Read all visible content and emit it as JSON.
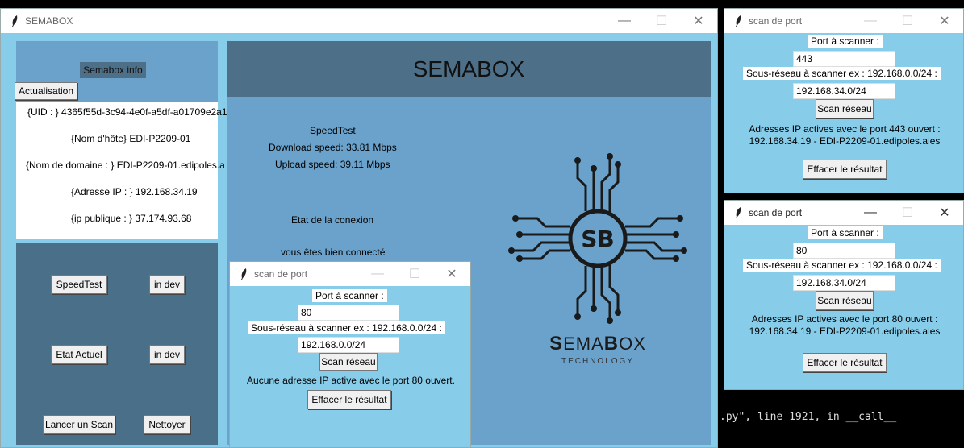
{
  "main_window": {
    "title": "SEMABOX",
    "sidebar_top": {
      "info_label": "Semabox info",
      "refresh_button": "Actualisation",
      "info_lines": [
        "{UID : } 4365f55d-3c94-4e0f-a5df-a01709e2a1",
        "{Nom d'hôte} EDI-P2209-01",
        "{Nom de domaine : } EDI-P2209-01.edipoles.a",
        "{Adresse IP : } 192.168.34.19",
        "{ip publique : } 37.174.93.68"
      ]
    },
    "sidebar_buttons": {
      "speedtest": "SpeedTest",
      "in_dev_1": "in dev",
      "etat_actuel": "Etat Actuel",
      "in_dev_2": "in dev",
      "lancer_scan": "Lancer un Scan",
      "nettoyer": "Nettoyer"
    },
    "content": {
      "header": "SEMABOX",
      "speedtest_title": "SpeedTest",
      "download": "Download speed: 33.81 Mbps",
      "upload": "Upload speed: 39.11 Mbps",
      "connection_title": "Etat de la conexion",
      "connection_status": "vous êtes bien connecté"
    },
    "logo": {
      "monogram": "SB",
      "brand_prefix": "S",
      "brand_middle": "EMA",
      "brand_b": "B",
      "brand_suffix": "OX",
      "tagline": "TECHNOLOGY"
    }
  },
  "scan_windows": [
    {
      "title": "scan de port",
      "port_label": "Port à scanner :",
      "port_value": "80",
      "subnet_label": "Sous-réseau à scanner ex : 192.168.0.0/24 :",
      "subnet_value": "192.168.0.0/24",
      "scan_button": "Scan réseau",
      "result": "Aucune adresse IP active avec le port 80 ouvert.",
      "clear_button": "Effacer le résultat"
    },
    {
      "title": "scan de port",
      "port_label": "Port à scanner :",
      "port_value": "443",
      "subnet_label": "Sous-réseau à scanner ex : 192.168.0.0/24 :",
      "subnet_value": "192.168.34.0/24",
      "scan_button": "Scan réseau",
      "result_line1": "Adresses IP actives avec le port 443 ouvert :",
      "result_line2": "192.168.34.19 - EDI-P2209-01.edipoles.ales",
      "clear_button": "Effacer le résultat"
    },
    {
      "title": "scan de port",
      "port_label": "Port à scanner :",
      "port_value": "80",
      "subnet_label": "Sous-réseau à scanner ex : 192.168.0.0/24 :",
      "subnet_value": "192.168.34.0/24",
      "scan_button": "Scan réseau",
      "result_line1": "Adresses IP actives avec le port 80 ouvert :",
      "result_line2": "192.168.34.19 - EDI-P2209-01.edipoles.ales",
      "clear_button": "Effacer le résultat"
    }
  ],
  "terminal": {
    "line": ".py\", line 1921, in __call__"
  },
  "window_controls": {
    "minimize": "—",
    "maximize": "☐",
    "close": "✕"
  },
  "colors": {
    "window_bg": "#87cdea",
    "sidebar_top": "#6aa2cc",
    "sidebar_bottom": "#4a6f88",
    "header_bar": "#4d6f88",
    "content_bg": "#6aa2cc",
    "logo": "#1a1a1a"
  }
}
